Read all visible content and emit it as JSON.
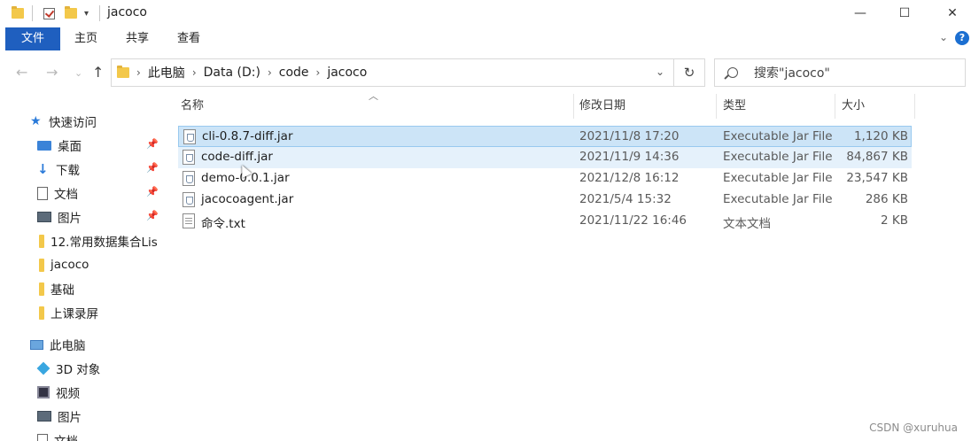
{
  "window": {
    "title": "jacoco"
  },
  "ribbon": {
    "tabs": [
      "文件",
      "主页",
      "共享",
      "查看"
    ]
  },
  "address": {
    "crumbs": [
      "此电脑",
      "Data (D:)",
      "code",
      "jacoco"
    ]
  },
  "search": {
    "placeholder": "搜索\"jacoco\""
  },
  "sidebar": {
    "quick_access": "快速访问",
    "items": [
      "桌面",
      "下载",
      "文档",
      "图片",
      "12.常用数据集合Lis",
      "jacoco",
      "基础",
      "上课录屏"
    ],
    "this_pc": "此电脑",
    "pc_items": [
      "3D 对象",
      "视频",
      "图片",
      "文档"
    ]
  },
  "columns": {
    "name": "名称",
    "date": "修改日期",
    "type": "类型",
    "size": "大小"
  },
  "files": [
    {
      "name": "cli-0.8.7-diff.jar",
      "date": "2021/11/8 17:20",
      "type": "Executable Jar File",
      "size": "1,120 KB",
      "kind": "jar"
    },
    {
      "name": "code-diff.jar",
      "date": "2021/11/9 14:36",
      "type": "Executable Jar File",
      "size": "84,867 KB",
      "kind": "jar"
    },
    {
      "name": "demo-0.0.1.jar",
      "date": "2021/12/8 16:12",
      "type": "Executable Jar File",
      "size": "23,547 KB",
      "kind": "jar"
    },
    {
      "name": "jacocoagent.jar",
      "date": "2021/5/4 15:32",
      "type": "Executable Jar File",
      "size": "286 KB",
      "kind": "jar"
    },
    {
      "name": "命令.txt",
      "date": "2021/11/22 16:46",
      "type": "文本文档",
      "size": "2 KB",
      "kind": "txt"
    }
  ],
  "watermark": "CSDN @xuruhua"
}
